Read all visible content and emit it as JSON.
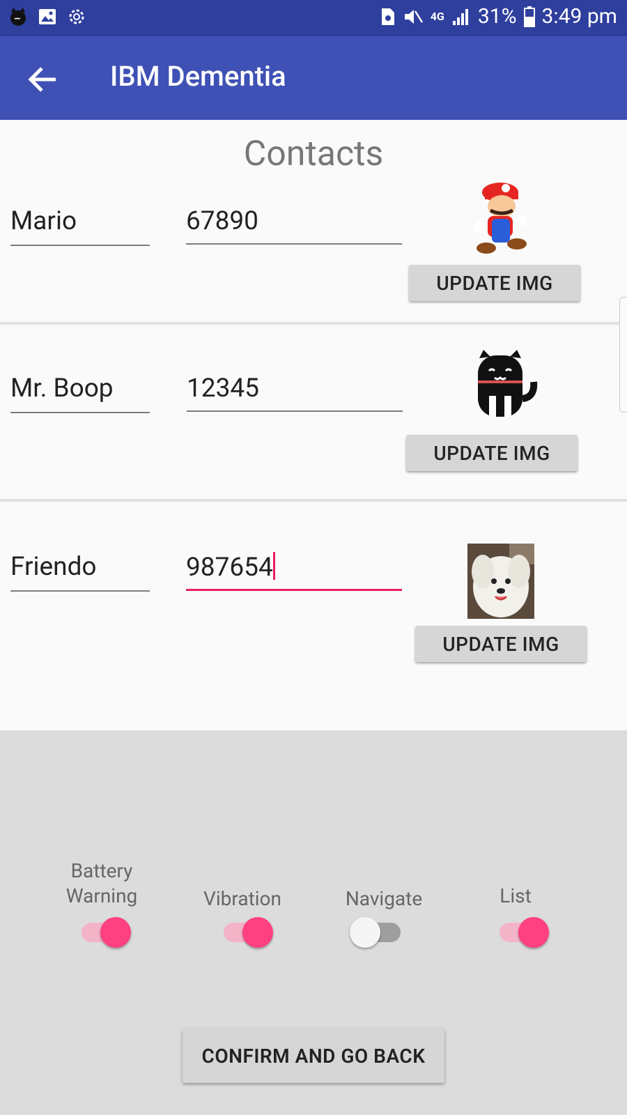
{
  "status_bar": {
    "battery_percent": "31%",
    "time": "3:49 pm",
    "network": "4G"
  },
  "app_bar": {
    "title": "IBM Dementia"
  },
  "contacts": {
    "title": "Contacts",
    "update_label": "UPDATE IMG",
    "items": [
      {
        "name": "Mario",
        "number": "67890"
      },
      {
        "name": "Mr. Boop",
        "number": "12345"
      },
      {
        "name": "Friendo",
        "number": "987654"
      }
    ]
  },
  "toggles": [
    {
      "label": "Battery Warning",
      "on": true
    },
    {
      "label": "Vibration",
      "on": true
    },
    {
      "label": "Navigate",
      "on": false
    },
    {
      "label": "List",
      "on": true
    }
  ],
  "confirm": {
    "label": "CONFIRM AND GO BACK"
  },
  "colors": {
    "status_bar": "#2f3f9e",
    "app_bar": "#3f51b5",
    "accent": "#ff4081"
  }
}
